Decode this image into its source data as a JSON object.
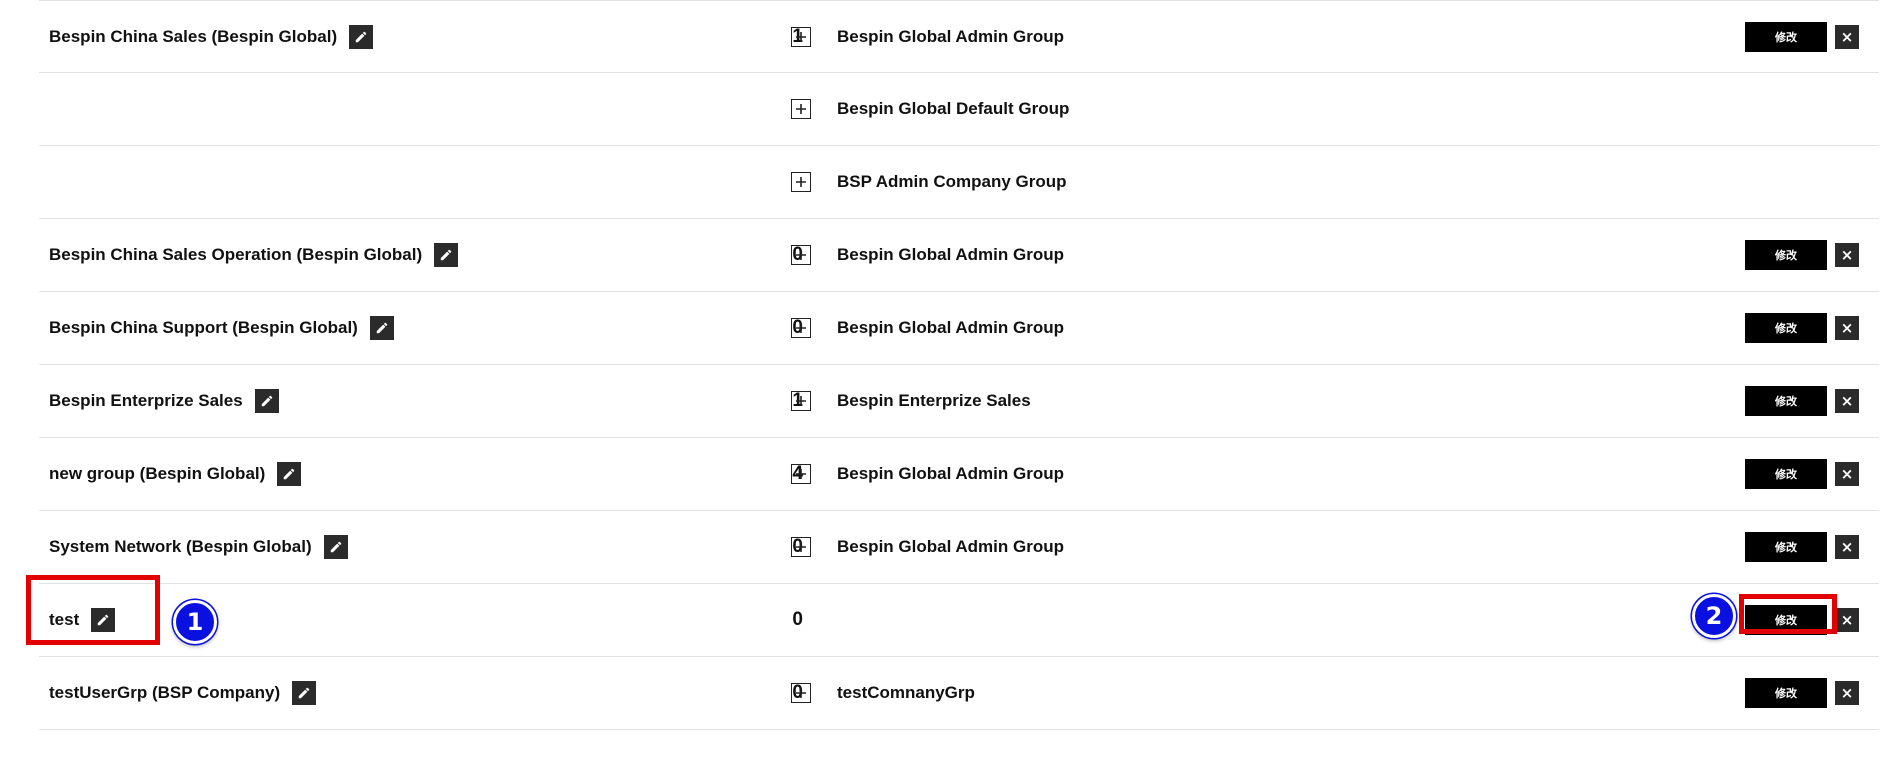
{
  "rows": [
    {
      "name": "Bespin China Sales (Bespin Global)",
      "count": "1",
      "group": "Bespin Global Admin Group",
      "modify_label": "修改",
      "delete_label": "×",
      "has_name": true,
      "has_actions": true
    },
    {
      "name": "",
      "count": "",
      "group": "Bespin Global Default Group",
      "has_name": false,
      "has_actions": false
    },
    {
      "name": "",
      "count": "",
      "group": "BSP Admin Company Group",
      "has_name": false,
      "has_actions": false
    },
    {
      "name": "Bespin China Sales Operation (Bespin Global)",
      "count": "0",
      "group": "Bespin Global Admin Group",
      "modify_label": "修改",
      "delete_label": "×",
      "has_name": true,
      "has_actions": true
    },
    {
      "name": "Bespin China Support (Bespin Global)",
      "count": "0",
      "group": "Bespin Global Admin Group",
      "modify_label": "修改",
      "delete_label": "×",
      "has_name": true,
      "has_actions": true
    },
    {
      "name": "Bespin Enterprize Sales",
      "count": "1",
      "group": "Bespin Enterprize Sales",
      "modify_label": "修改",
      "delete_label": "×",
      "has_name": true,
      "has_actions": true
    },
    {
      "name": "new group (Bespin Global)",
      "count": "4",
      "group": "Bespin Global Admin Group",
      "modify_label": "修改",
      "delete_label": "×",
      "has_name": true,
      "has_actions": true
    },
    {
      "name": "System Network (Bespin Global)",
      "count": "0",
      "group": "Bespin Global Admin Group",
      "modify_label": "修改",
      "delete_label": "×",
      "has_name": true,
      "has_actions": true
    },
    {
      "name": "test",
      "count": "0",
      "group": "",
      "modify_label": "修改",
      "delete_label": "×",
      "has_name": true,
      "has_actions": true
    },
    {
      "name": "testUserGrp (BSP Company)",
      "count": "0",
      "group": "testComnanyGrp",
      "modify_label": "修改",
      "delete_label": "×",
      "has_name": true,
      "has_actions": true
    }
  ],
  "annotations": {
    "step1_label": "1",
    "step2_label": "2",
    "highlight_color": "#e30000",
    "badge_color": "#0a10e0"
  },
  "icons": {
    "edit": "pencil-icon",
    "expand": "plus-square-icon",
    "delete": "close-icon"
  }
}
